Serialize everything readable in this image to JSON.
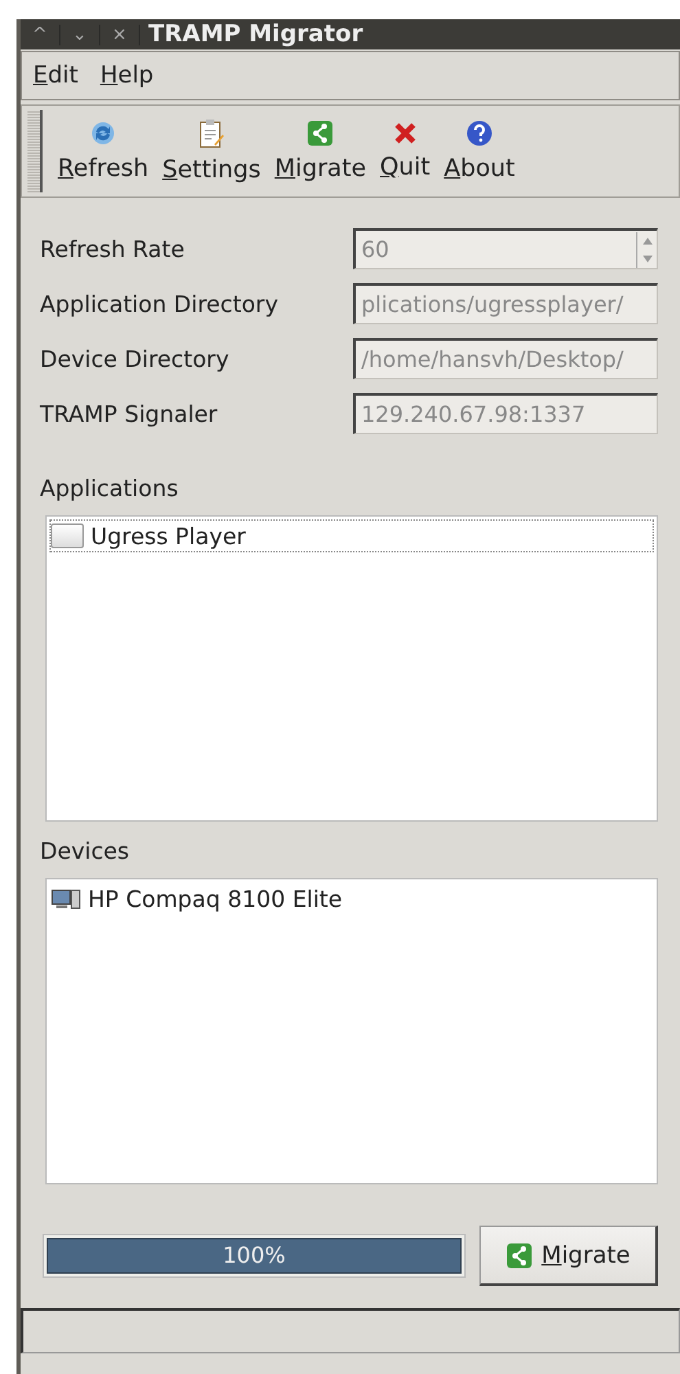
{
  "window": {
    "title": "TRAMP Migrator",
    "controls": [
      "^",
      "⌄",
      "×"
    ]
  },
  "menu": [
    {
      "label": "Edit",
      "mnemonic": true
    },
    {
      "label": "Help",
      "mnemonic": true
    }
  ],
  "toolbar": [
    {
      "label": "Refresh",
      "kind": "refresh",
      "mnemonic": true
    },
    {
      "label": "Settings",
      "kind": "settings",
      "mnemonic": true
    },
    {
      "label": "Migrate",
      "kind": "migrate",
      "mnemonic": true
    },
    {
      "label": "Quit",
      "kind": "quit",
      "mnemonic": true
    },
    {
      "label": "About",
      "kind": "about",
      "mnemonic": true
    }
  ],
  "settings": [
    {
      "label": "Refresh Rate",
      "value": "60",
      "kind": "spin"
    },
    {
      "label": "Application Directory",
      "value": "plications/ugressplayer/",
      "kind": "text"
    },
    {
      "label": "Device Directory",
      "value": "/home/hansvh/Desktop/",
      "kind": "text"
    },
    {
      "label": "TRAMP Signaler",
      "value": "129.240.67.98:1337",
      "kind": "text"
    }
  ],
  "applications": {
    "label": "Applications",
    "items": [
      {
        "name": "Ugress Player",
        "checked": false,
        "selected": true
      }
    ]
  },
  "devices": {
    "label": "Devices",
    "items": [
      {
        "name": "HP Compaq 8100 Elite",
        "selected": false
      }
    ]
  },
  "progress": {
    "level": 1,
    "text": "100%"
  },
  "migrate_button": {
    "label": "Migrate",
    "mnemonic": true
  }
}
